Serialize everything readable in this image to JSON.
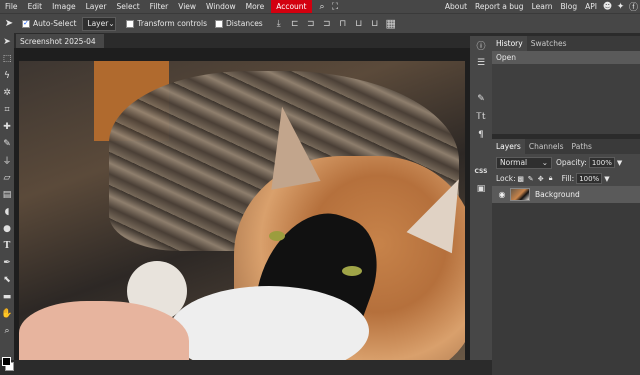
{
  "menubar": {
    "items": [
      "File",
      "Edit",
      "Image",
      "Layer",
      "Select",
      "Filter",
      "View",
      "Window",
      "More"
    ],
    "account": "Account",
    "right": [
      "About",
      "Report a bug",
      "Learn",
      "Blog",
      "API"
    ],
    "icons": [
      "search-icon",
      "fullscreen-icon",
      "reddit-icon",
      "twitter-icon",
      "facebook-icon"
    ]
  },
  "options": {
    "auto_select": "Auto-Select",
    "layer_select": "Layer",
    "transform_controls": "Transform controls",
    "distances": "Distances"
  },
  "document": {
    "tab_title": "Screenshot 2025-04"
  },
  "history": {
    "tabs": [
      "History",
      "Swatches"
    ],
    "items": [
      "Open"
    ]
  },
  "layers": {
    "tabs": [
      "Layers",
      "Channels",
      "Paths"
    ],
    "blend_mode": "Normal",
    "opacity_label": "Opacity:",
    "opacity_value": "100%",
    "lock_label": "Lock:",
    "fill_label": "Fill:",
    "fill_value": "100%",
    "items": [
      {
        "name": "Background"
      }
    ]
  },
  "mini_panel": {
    "css_label": "CSS"
  }
}
